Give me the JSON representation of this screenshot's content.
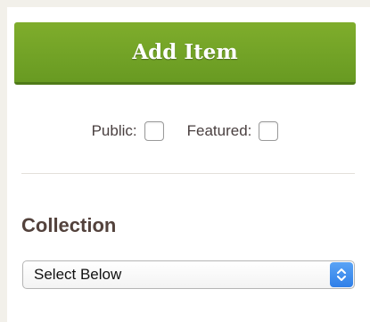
{
  "actions": {
    "add_item_label": "Add Item"
  },
  "flags": {
    "public_label": "Public:",
    "public_checked": false,
    "featured_label": "Featured:",
    "featured_checked": false
  },
  "collection": {
    "heading": "Collection",
    "selected_value": "Select Below",
    "arrow_icon": "up-down-chevron-icon"
  },
  "colors": {
    "primary_button": "#7aa82a",
    "heading_text": "#53423c",
    "select_accent": "#3d8cf0"
  }
}
